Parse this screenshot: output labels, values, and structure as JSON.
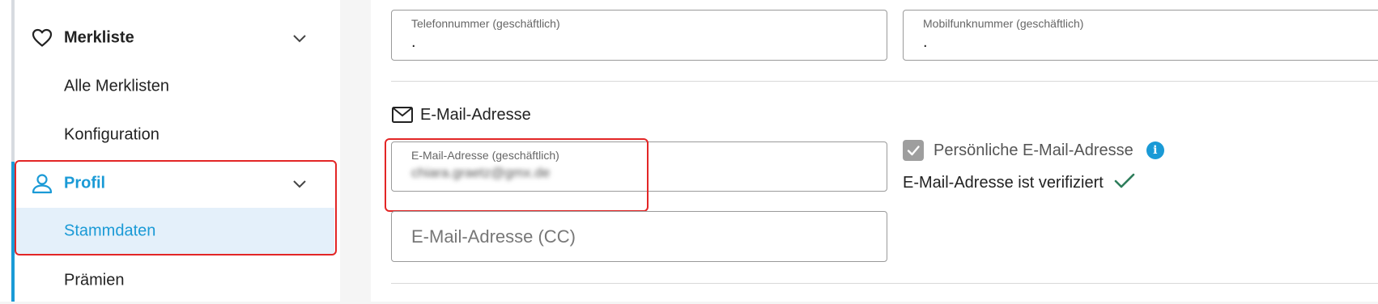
{
  "sidebar": {
    "groups": [
      {
        "label": "Merkliste",
        "icon": "heart-icon",
        "items": [
          "Alle Merklisten",
          "Konfiguration"
        ]
      },
      {
        "label": "Profil",
        "icon": "user-icon",
        "items": [
          "Stammdaten",
          "Prämien"
        ],
        "selected_item": "Stammdaten"
      }
    ]
  },
  "main": {
    "phone_fields": [
      {
        "label": "Telefonnummer (geschäftlich)",
        "value": "."
      },
      {
        "label": "Mobilfunknummer (geschäftlich)",
        "value": "."
      }
    ],
    "email_section": {
      "title": "E-Mail-Adresse",
      "business_email": {
        "label": "E-Mail-Adresse (geschäftlich)",
        "value": "chiara.graetz@gmx.de"
      },
      "cc_email": {
        "placeholder": "E-Mail-Adresse (CC)"
      },
      "personal_checkbox_label": "Persönliche E-Mail-Adresse",
      "personal_checkbox_checked": true,
      "verified_text": "E-Mail-Adresse ist verifiziert"
    }
  },
  "colors": {
    "accent": "#1a9ad6",
    "highlight": "#e32626",
    "verified": "#2e7d5b"
  }
}
